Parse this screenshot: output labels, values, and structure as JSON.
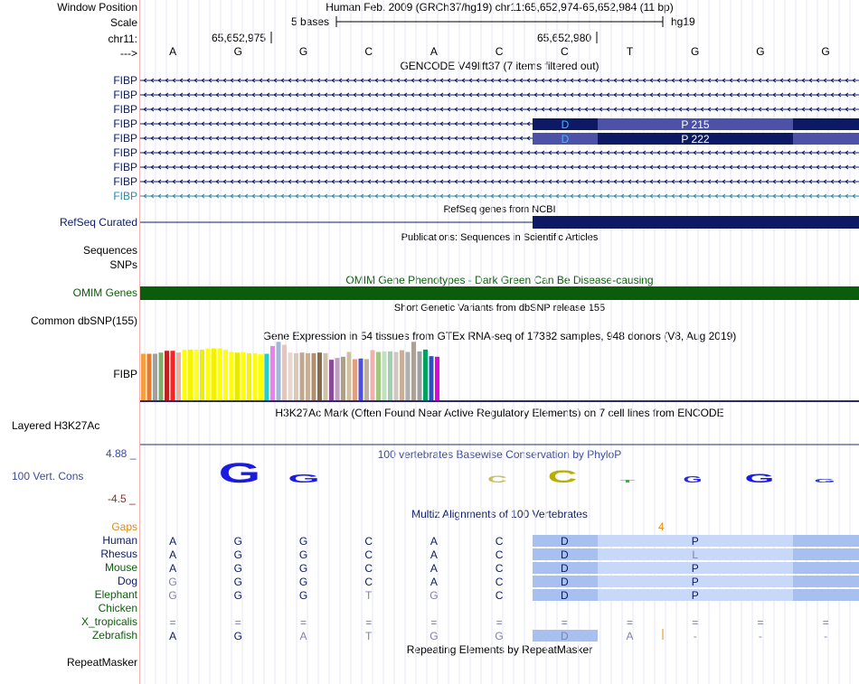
{
  "header": {
    "window_label": "Window Position",
    "scale_label": "Scale",
    "chrom_label": "chr11:",
    "strand_label": "--->",
    "position": "Human Feb. 2009 (GRCh37/hg19)   chr11:65,652,974-65,652,984 (11 bp)",
    "scale_text": "5 bases",
    "scale_db": "hg19",
    "coord_1": "65,652,975",
    "coord_2": "65,652,980"
  },
  "bases": [
    "A",
    "G",
    "G",
    "C",
    "A",
    "C",
    "C",
    "T",
    "G",
    "G",
    "G"
  ],
  "gencode": {
    "title": "GENCODE V49lift37 (7 items filtered out)",
    "items": [
      "FIBP",
      "FIBP",
      "FIBP",
      "FIBP",
      "FIBP",
      "FIBP",
      "FIBP",
      "FIBP",
      "FIBP"
    ],
    "codon_row4": [
      "D",
      "P 215"
    ],
    "codon_row5": [
      "D",
      "P 222"
    ]
  },
  "refseq": {
    "title": "RefSeq genes from NCBI",
    "label": "RefSeq Curated"
  },
  "pubs": {
    "title": "Publications: Sequences in Scientific Articles",
    "labels": [
      "Sequences",
      "SNPs"
    ]
  },
  "omim": {
    "title": "OMIM Gene Phenotypes - Dark Green Can Be Disease-causing",
    "label": "OMIM Genes"
  },
  "dbsnp": {
    "title": "Short Genetic Variants from dbSNP release 155",
    "label": "Common dbSNP(155)"
  },
  "gtex": {
    "title": "Gene Expression in 54 tissues from GTEx RNA-seq of 17382 samples, 948 donors (V8, Aug 2019)",
    "label": "FIBP",
    "colors": [
      "#f4a040",
      "#e8792a",
      "#a0a0a0",
      "#7fae6d",
      "#c02020",
      "#ff2020",
      "#f0b0a0",
      "#ffff00",
      "#f5f500",
      "#ffff20",
      "#eeee00",
      "#ffff00",
      "#f2f200",
      "#ffff00",
      "#ffff10",
      "#ffff00",
      "#eaea00",
      "#ffff00",
      "#f5f500",
      "#ffff00",
      "#ffff00",
      "#20d0d0",
      "#ee80ee",
      "#a0b8d8",
      "#e0c8c0",
      "#e8d8d0",
      "#dcc8b8",
      "#c0a890",
      "#c8b098",
      "#b09070",
      "#8a6a4a",
      "#d0c0a8",
      "#8a4a9a",
      "#c0a0c0",
      "#b0a080",
      "#d0c0a0",
      "#e0a080",
      "#5050e0",
      "#c0b0a0",
      "#f0b0b0",
      "#a0c880",
      "#c0e0c0",
      "#a0d0b0",
      "#d0c8c0",
      "#c8b098",
      "#b0b0b0",
      "#b0a090",
      "#a0a0a0",
      "#00a060",
      "#3050c0",
      "#e000e0"
    ],
    "values": [
      0.78,
      0.78,
      0.78,
      0.8,
      0.83,
      0.83,
      0.8,
      0.85,
      0.85,
      0.85,
      0.85,
      0.87,
      0.87,
      0.87,
      0.85,
      0.81,
      0.8,
      0.81,
      0.79,
      0.79,
      0.77,
      0.78,
      0.91,
      0.98,
      0.93,
      0.8,
      0.79,
      0.8,
      0.79,
      0.79,
      0.8,
      0.79,
      0.68,
      0.71,
      0.73,
      0.81,
      0.69,
      0.7,
      0.69,
      0.84,
      0.81,
      0.82,
      0.82,
      0.81,
      0.84,
      0.81,
      0.98,
      0.82,
      0.85,
      0.74,
      0.73
    ]
  },
  "h3k27ac": {
    "title": "H3K27Ac Mark (Often Found Near Active Regulatory Elements) on 7 cell lines from ENCODE",
    "label": "Layered H3K27Ac"
  },
  "phylop": {
    "title": "100 vertebrates Basewise Conservation by PhyloP",
    "label": "100 Vert. Cons",
    "max": "4.88 _",
    "min": "-4.5 _"
  },
  "multiz": {
    "title": "Multiz Alignments of 100 Vertebrates",
    "gaps_label": "Gaps",
    "gap_count": "4",
    "species": [
      {
        "name": "Human",
        "row": [
          "A",
          "G",
          "G",
          "C",
          "A",
          "C",
          "D",
          "",
          "P",
          "",
          ""
        ]
      },
      {
        "name": "Rhesus",
        "row": [
          "A",
          "G",
          "G",
          "C",
          "A",
          "C",
          "D",
          "",
          "L",
          "",
          ""
        ]
      },
      {
        "name": "Mouse",
        "row": [
          "A",
          "G",
          "G",
          "C",
          "A",
          "C",
          "D",
          "",
          "P",
          "",
          ""
        ]
      },
      {
        "name": "Dog",
        "row": [
          "G",
          "G",
          "G",
          "C",
          "A",
          "C",
          "D",
          "",
          "P",
          "",
          ""
        ]
      },
      {
        "name": "Elephant",
        "row": [
          "G",
          "G",
          "G",
          "T",
          "G",
          "C",
          "D",
          "",
          "P",
          "",
          ""
        ]
      },
      {
        "name": "Chicken",
        "row": [
          "",
          "",
          "",
          "",
          "",
          "",
          "",
          "",
          "",
          "",
          ""
        ]
      },
      {
        "name": "X_tropicalis",
        "row": [
          "=",
          "=",
          "=",
          "=",
          "=",
          "=",
          "=",
          "=",
          "=",
          "=",
          "="
        ]
      },
      {
        "name": "Zebrafish",
        "row": [
          "A",
          "G",
          "A",
          "T",
          "G",
          "G",
          "D",
          "A",
          "-",
          "-",
          "-"
        ]
      }
    ]
  },
  "repeatmasker": {
    "title": "Repeating Elements by RepeatMasker",
    "label": "RepeatMasker"
  },
  "colors": {
    "navy": "#0c1a66",
    "omim_green": "#0b5d0b",
    "codon_dark": "#0c1a66",
    "codon_light": "#4c52a8",
    "maf_light": "#c8d8f8",
    "maf_dark": "#a8c0f0"
  }
}
